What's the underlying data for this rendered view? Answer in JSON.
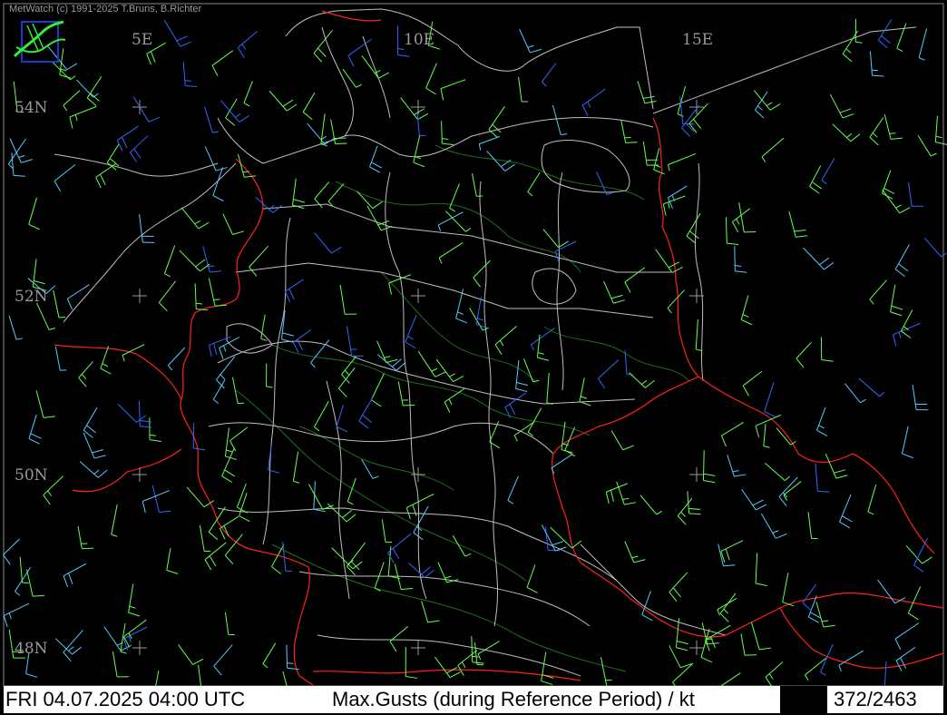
{
  "credit": "MetWatch  (c) 1991-2025 T.Bruns, B.Richter",
  "longitude_labels": [
    "5E",
    "10E",
    "15E"
  ],
  "latitude_labels": [
    "54N",
    "52N",
    "50N",
    "48N"
  ],
  "status": {
    "datetime": "FRI 04.07.2025 04:00 UTC",
    "parameter": "Max.Gusts (during Reference Period) / kt",
    "count": "372/2463"
  },
  "colors": {
    "background": "#000000",
    "coastline": "#bfbfbf",
    "national_border": "#ff2020",
    "terrain_contour": "#1e6e1e",
    "barb_green": "#66ff55",
    "barb_cyan": "#55ccff",
    "barb_blue": "#3366ff"
  },
  "icons": [
    "metwatch-logo-icon",
    "crosshair-icon",
    "wind-barb-icon"
  ]
}
